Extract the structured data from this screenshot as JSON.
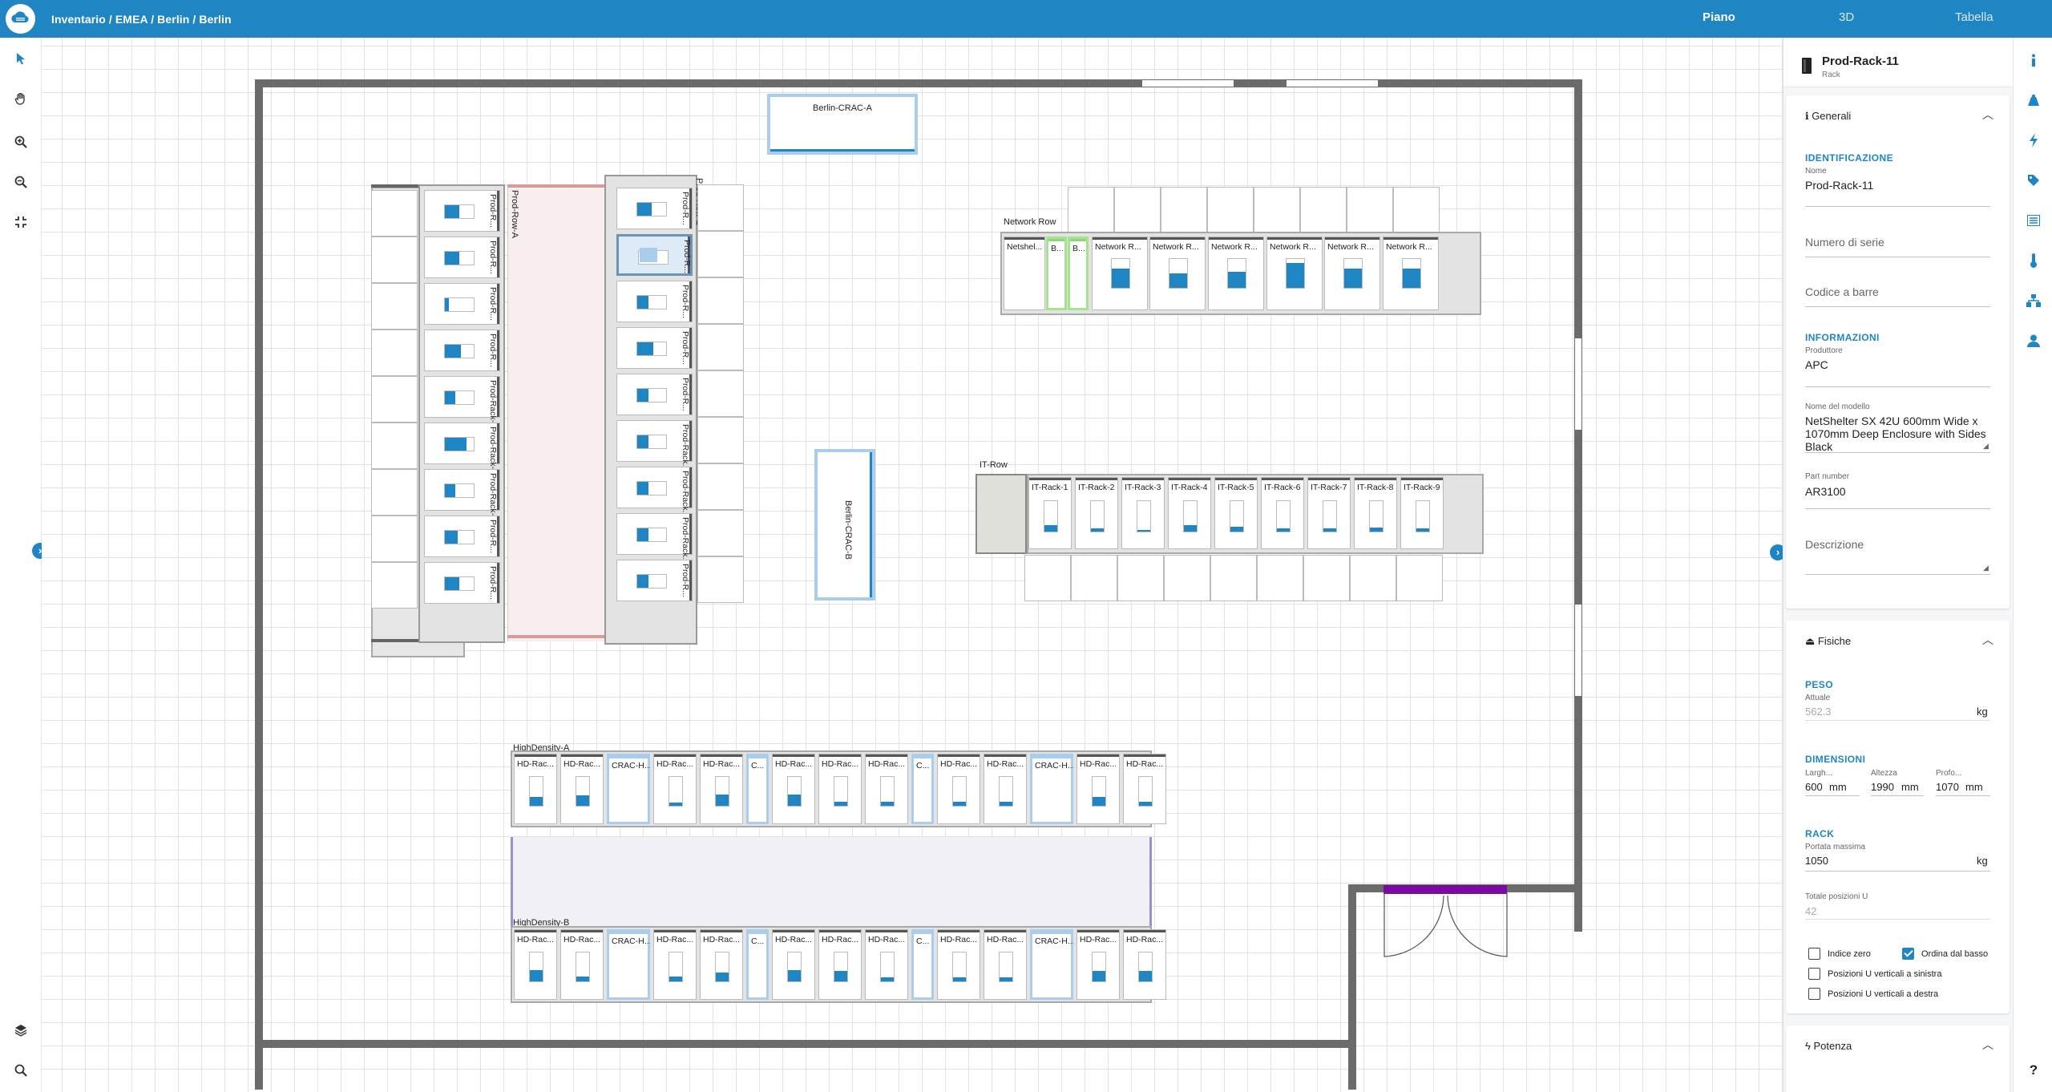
{
  "topbar": {
    "breadcrumb": "Inventario / EMEA / Berlin / Berlin",
    "views": [
      {
        "label": "Piano"
      },
      {
        "label": "3D"
      },
      {
        "label": "Tabella"
      }
    ]
  },
  "floor": {
    "crac_a": "Berlin-CRAC-A",
    "crac_b": "Berlin-CRAC-B",
    "prod_row_a": "Prod-Row-A",
    "prod_row_b": "Prod-Row-B",
    "prod_a_racks": [
      "Prod-R...",
      "Prod-R...",
      "Prod-R...",
      "Prod-R...",
      "Prod-Rack-5",
      "Prod-Rack-6",
      "Prod-Rack-7",
      "Prod-R...",
      "Prod-R..."
    ],
    "prod_a_fill": [
      0.5,
      0.5,
      0.15,
      0.55,
      0.35,
      0.75,
      0.35,
      0.45,
      0.5
    ],
    "prod_b_racks": [
      "Prod-R...",
      "Prod-R...",
      "Prod-R...",
      "Prod-R...",
      "Prod-R...",
      "Prod-Rack...",
      "Prod-Rack...",
      "Prod-Rack...",
      "Prod-R..."
    ],
    "prod_b_fill": [
      0.5,
      0,
      0.4,
      0.55,
      0.4,
      0.4,
      0.4,
      0.4,
      0.4
    ],
    "network_row": "Network Row",
    "network_racks": [
      "Netshel...",
      "B...",
      "B...",
      "Network R...",
      "Network R...",
      "Network R...",
      "Network R...",
      "Network R...",
      "Network R..."
    ],
    "network_fill": [
      0,
      0,
      0,
      0.68,
      0.5,
      0.55,
      0.85,
      0.68,
      0.68
    ],
    "it_row": "IT-Row",
    "it_racks": [
      "IT-Rack-1",
      "IT-Rack-2",
      "IT-Rack-3",
      "IT-Rack-4",
      "IT-Rack-5",
      "IT-Rack-6",
      "IT-Rack-7",
      "IT-Rack-8",
      "IT-Rack-9"
    ],
    "it_fill": [
      0.2,
      0.1,
      0.06,
      0.2,
      0.15,
      0.1,
      0.1,
      0.12,
      0.1
    ],
    "hd_a": "HighDensity-A",
    "hd_b": "HighDensity-B",
    "hd_racks": [
      "HD-Rac...",
      "HD-Rac...",
      "CRAC-H...",
      "HD-Rac...",
      "HD-Rac...",
      "C...",
      "HD-Rac...",
      "HD-Rac...",
      "HD-Rac...",
      "C...",
      "HD-Rac...",
      "HD-Rac...",
      "CRAC-H...",
      "HD-Rac...",
      "HD-Rac..."
    ],
    "hd_a_fill": [
      0.3,
      0.35,
      0,
      0.1,
      0.38,
      0,
      0.38,
      0.15,
      0.15,
      0,
      0.15,
      0.15,
      0,
      0.3,
      0.15
    ],
    "hd_b_fill": [
      0.38,
      0.18,
      0,
      0.18,
      0.3,
      0,
      0.38,
      0.35,
      0.15,
      0,
      0.15,
      0.15,
      0,
      0.35,
      0.35
    ],
    "colors": {
      "accent": "#1f86c3",
      "wall": "#6b6b6b",
      "door": "#7a0ba0",
      "aisle_red": "#d99a9a",
      "aisle_purple": "#9a8fd0"
    }
  },
  "panel": {
    "title": "Prod-Rack-11",
    "subtitle": "Rack",
    "generali": {
      "title": "Generali",
      "identificazione": "IDENTIFICAZIONE",
      "nome_label": "Nome",
      "nome_value": "Prod-Rack-11",
      "seriale_placeholder": "Numero di serie",
      "barcode_placeholder": "Codice a barre",
      "informazioni": "INFORMAZIONI",
      "produttore_label": "Produttore",
      "produttore_value": "APC",
      "modello_label": "Nome del modello",
      "modello_value": "NetShelter SX 42U 600mm Wide x 1070mm Deep Enclosure with Sides Black",
      "partnumber_label": "Part number",
      "partnumber_value": "AR3100",
      "descrizione_placeholder": "Descrizione"
    },
    "fisiche": {
      "title": "Fisiche",
      "peso": "PESO",
      "attuale_label": "Attuale",
      "attuale_value": "562.3",
      "kg": "kg",
      "dimensioni": "DIMENSIONI",
      "largh_label": "Largh...",
      "largh_value": "600",
      "altezza_label": "Altezza",
      "altezza_value": "1990",
      "profo_label": "Profo...",
      "profo_value": "1070",
      "mm": "mm",
      "rack": "RACK",
      "portata_label": "Portata massima",
      "portata_value": "1050",
      "totale_label": "Totale posizioni U",
      "totale_value": "42",
      "indice_zero": "Indice zero",
      "ordina_basso": "Ordina dal basso",
      "pos_sinistra": "Posizioni U verticali a sinistra",
      "pos_destra": "Posizioni U verticali a destra"
    },
    "potenza": {
      "title": "Potenza"
    }
  },
  "icons": {
    "logo": "cloud-logo-icon",
    "tools": [
      "pointer-icon",
      "hand-icon",
      "zoom-in-icon",
      "zoom-out-icon",
      "fit-screen-icon",
      "layers-icon",
      "search-icon"
    ],
    "strip": [
      "info-icon",
      "weight-icon",
      "power-icon",
      "tag-icon",
      "list-icon",
      "temperature-icon",
      "network-icon",
      "user-icon",
      "help-icon"
    ]
  }
}
